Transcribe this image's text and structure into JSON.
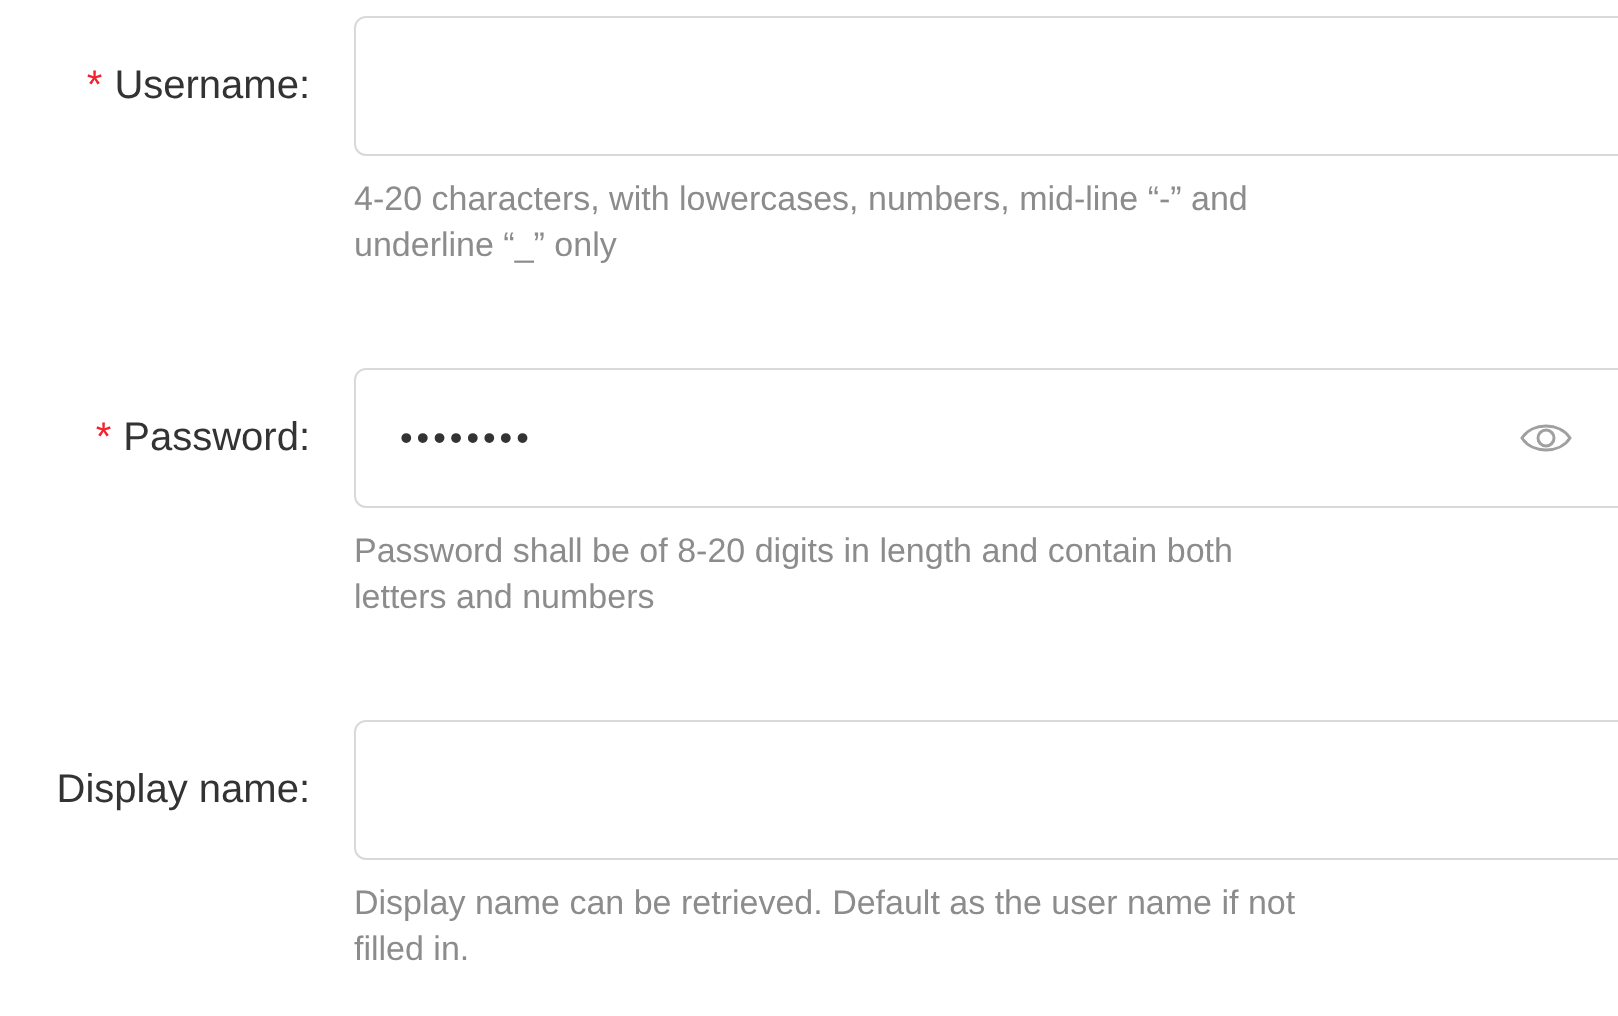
{
  "fields": [
    {
      "kind": "text",
      "required_mark": "*",
      "label": "Username:",
      "help": "4-20 characters, with lowercases, numbers, mid-line “-” and underline “_” only"
    },
    {
      "kind": "password",
      "required_mark": "*",
      "label": "Password:",
      "value": "••••••••",
      "help": "Password shall be of 8-20 digits in length and contain both letters and numbers"
    },
    {
      "kind": "text",
      "label": "Display name:",
      "help": "Display name can be retrieved. Default as the user name if not filled in."
    }
  ]
}
